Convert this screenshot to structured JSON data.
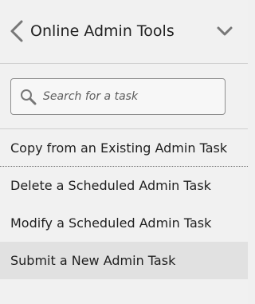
{
  "header": {
    "title": "Online Admin Tools",
    "back_icon": "chevron-left-icon",
    "menu_icon": "chevron-down-icon"
  },
  "search": {
    "placeholder": "Search for a task",
    "value": "",
    "icon": "search-icon"
  },
  "tasks": [
    {
      "label": "Copy from an Existing Admin Task"
    },
    {
      "label": "Delete a Scheduled Admin Task"
    },
    {
      "label": "Modify a Scheduled Admin Task"
    },
    {
      "label": "Submit a New Admin Task"
    }
  ],
  "colors": {
    "panel_background": "#f1f1f1",
    "selected_row_background": "#e1e1e1",
    "border": "#cfcfcf",
    "text": "#1f1f1f",
    "icon": "#666666"
  }
}
